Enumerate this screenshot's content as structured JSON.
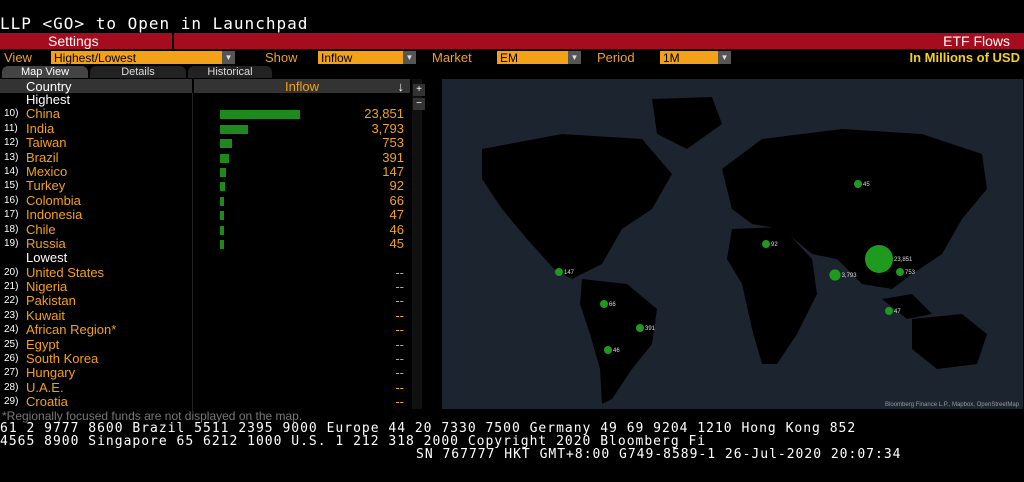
{
  "command_line": "LLP <GO> to Open in Launchpad",
  "settings_label": "Settings",
  "etf_flows_label": "ETF Flows",
  "controls": {
    "view_label": "View",
    "view_value": "Highest/Lowest",
    "show_label": "Show",
    "show_value": "Inflow",
    "market_label": "Market",
    "market_value": "EM",
    "period_label": "Period",
    "period_value": "1M",
    "units": "In Millions of USD"
  },
  "tabs": [
    "Map View",
    "Details",
    "Historical"
  ],
  "table": {
    "country_header": "Country",
    "inflow_header": "Inflow",
    "sort_icon": "↓",
    "highest_label": "Highest",
    "lowest_label": "Lowest",
    "highest": [
      {
        "num": "10)",
        "name": "China",
        "value": "23,851",
        "amount": 23851
      },
      {
        "num": "11)",
        "name": "India",
        "value": "3,793",
        "amount": 3793
      },
      {
        "num": "12)",
        "name": "Taiwan",
        "value": "753",
        "amount": 753
      },
      {
        "num": "13)",
        "name": "Brazil",
        "value": "391",
        "amount": 391
      },
      {
        "num": "14)",
        "name": "Mexico",
        "value": "147",
        "amount": 147
      },
      {
        "num": "15)",
        "name": "Turkey",
        "value": "92",
        "amount": 92
      },
      {
        "num": "16)",
        "name": "Colombia",
        "value": "66",
        "amount": 66
      },
      {
        "num": "17)",
        "name": "Indonesia",
        "value": "47",
        "amount": 47
      },
      {
        "num": "18)",
        "name": "Chile",
        "value": "46",
        "amount": 46
      },
      {
        "num": "19)",
        "name": "Russia",
        "value": "45",
        "amount": 45
      }
    ],
    "lowest": [
      {
        "num": "20)",
        "name": "United States",
        "value": "--"
      },
      {
        "num": "21)",
        "name": "Nigeria",
        "value": "--"
      },
      {
        "num": "22)",
        "name": "Pakistan",
        "value": "--"
      },
      {
        "num": "23)",
        "name": "Kuwait",
        "value": "--"
      },
      {
        "num": "24)",
        "name": "African Region*",
        "value": "--"
      },
      {
        "num": "25)",
        "name": "Egypt",
        "value": "--"
      },
      {
        "num": "26)",
        "name": "South Korea",
        "value": "--"
      },
      {
        "num": "27)",
        "name": "Hungary",
        "value": "--"
      },
      {
        "num": "28)",
        "name": "U.A.E.",
        "value": "--"
      },
      {
        "num": "29)",
        "name": "Croatia",
        "value": "--"
      }
    ]
  },
  "map": {
    "bubbles": [
      {
        "label": "23,851",
        "value": 23851
      },
      {
        "label": "3,793",
        "value": 3793
      },
      {
        "label": "753",
        "value": 753
      },
      {
        "label": "391",
        "value": 391
      },
      {
        "label": "147",
        "value": 147
      },
      {
        "label": "92",
        "value": 92
      },
      {
        "label": "66",
        "value": 66
      },
      {
        "label": "47",
        "value": 47
      },
      {
        "label": "46",
        "value": 46
      },
      {
        "label": "45",
        "value": 45
      }
    ],
    "attribution": "Bloomberg Finance L.P., Mapbox, OpenStreetMap",
    "zoom_in": "+",
    "zoom_out": "−",
    "bubble_color": "#1e9a1e",
    "ocean_color": "#1c2430"
  },
  "footnote": "*Regionally focused funds are not displayed on the map.",
  "ticker": {
    "line1": "61 2 9777 8600 Brazil 5511 2395 9000 Europe 44 20 7330 7500 Germany 49 69 9204 1210 Hong Kong 852",
    "line2": "4565 8900      Singapore 65 6212 1000      U.S. 1 212 318 2000       Copyright 2020 Bloomberg Fi",
    "line3": "SN 767777 HKT  GMT+8:00 G749-8589-1 26-Jul-2020 20:07:34"
  }
}
